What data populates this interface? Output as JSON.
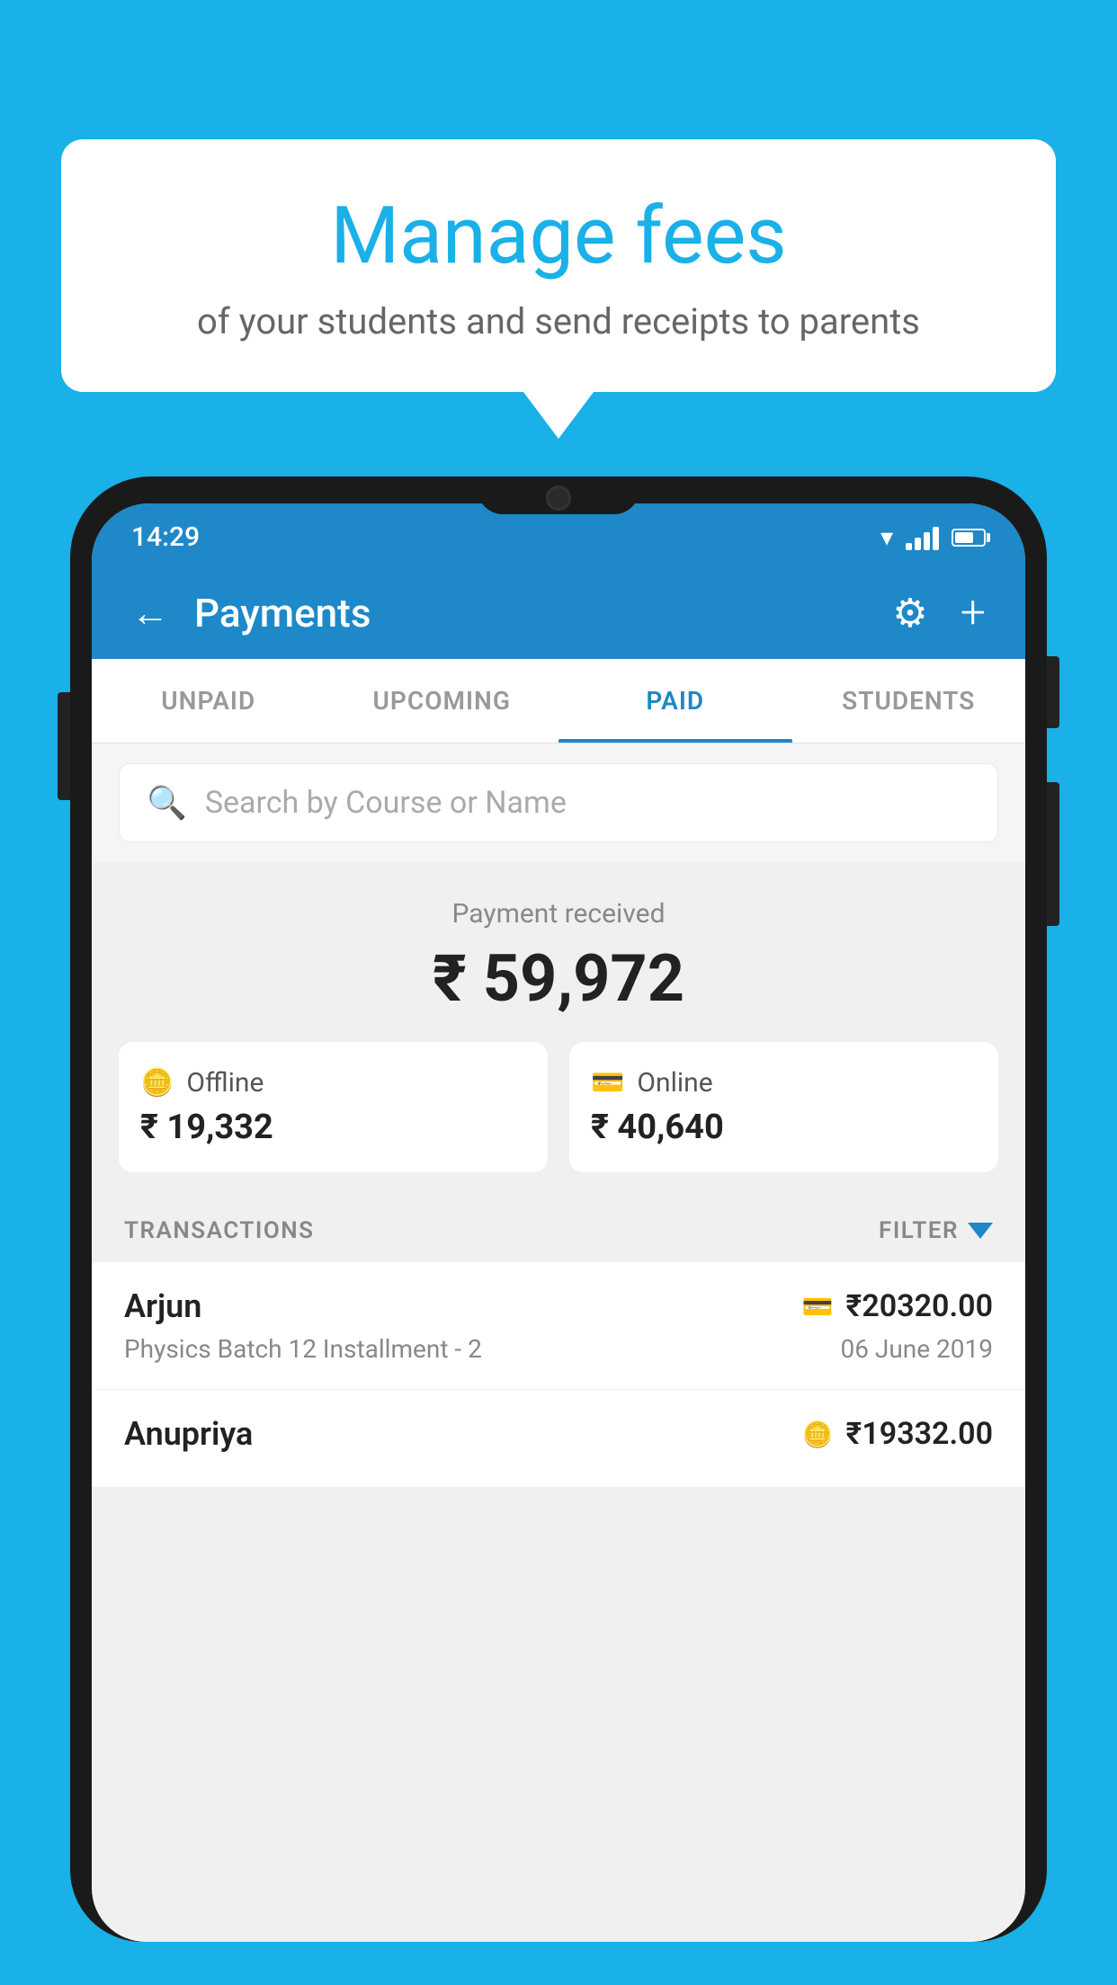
{
  "background_color": "#1ab0e8",
  "bubble": {
    "title": "Manage fees",
    "subtitle": "of your students and send receipts to parents"
  },
  "status_bar": {
    "time": "14:29"
  },
  "header": {
    "title": "Payments",
    "back_label": "←",
    "settings_label": "⚙",
    "add_label": "+"
  },
  "tabs": [
    {
      "label": "UNPAID",
      "active": false
    },
    {
      "label": "UPCOMING",
      "active": false
    },
    {
      "label": "PAID",
      "active": true
    },
    {
      "label": "STUDENTS",
      "active": false
    }
  ],
  "search": {
    "placeholder": "Search by Course or Name"
  },
  "payment_summary": {
    "label": "Payment received",
    "amount": "₹ 59,972",
    "cards": [
      {
        "label": "Offline",
        "amount": "₹ 19,332"
      },
      {
        "label": "Online",
        "amount": "₹ 40,640"
      }
    ]
  },
  "transactions": {
    "header_label": "TRANSACTIONS",
    "filter_label": "FILTER",
    "rows": [
      {
        "name": "Arjun",
        "amount": "₹20320.00",
        "course": "Physics Batch 12 Installment - 2",
        "date": "06 June 2019",
        "payment_type": "online"
      },
      {
        "name": "Anupriya",
        "amount": "₹19332.00",
        "course": "",
        "date": "",
        "payment_type": "offline"
      }
    ]
  }
}
